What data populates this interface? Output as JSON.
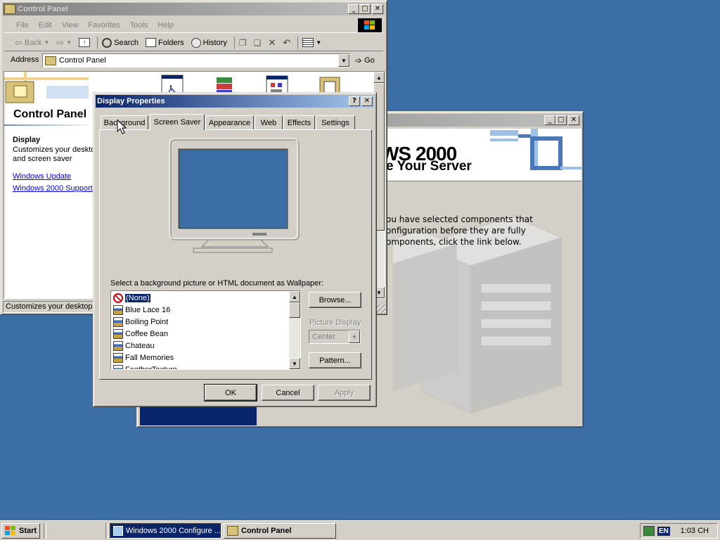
{
  "control_panel": {
    "title": "Control Panel",
    "menu": [
      "File",
      "Edit",
      "View",
      "Favorites",
      "Tools",
      "Help"
    ],
    "toolbar": {
      "back": "Back",
      "search": "Search",
      "folders": "Folders",
      "history": "History"
    },
    "address_label": "Address",
    "address_value": "Control Panel",
    "go_label": "Go",
    "heading": "Control Panel",
    "section_title": "Display",
    "section_desc_1": "Customizes your deskto",
    "section_desc_2": "and screen saver",
    "link_1": "Windows Update",
    "link_2": "Windows 2000 Support",
    "status": "Customizes your desktop d"
  },
  "configure_window": {
    "banner_logo": "WS 2000",
    "banner_sub": "e Your Server",
    "text_1": "ou have selected components that",
    "text_2": "onfiguration before they are fully",
    "text_3": "omponents, click the link below."
  },
  "display_props": {
    "title": "Display Properties",
    "tabs": [
      "Background",
      "Screen Saver",
      "Appearance",
      "Web",
      "Effects",
      "Settings"
    ],
    "selected_tab": "Screen Saver",
    "wallpaper_label": "Select a background picture or HTML document as Wallpaper:",
    "wallpapers": [
      "(None)",
      "Blue Lace 16",
      "Boiling Point",
      "Coffee Bean",
      "Chateau",
      "Fall Memories",
      "FeatherTexture"
    ],
    "selected_wallpaper": "(None)",
    "browse": "Browse...",
    "picture_display_label": "Picture Display:",
    "picture_display_value": "Center",
    "pattern": "Pattern...",
    "ok": "OK",
    "cancel": "Cancel",
    "apply": "Apply",
    "preview_color": "#3a6ea5"
  },
  "taskbar": {
    "start": "Start",
    "tasks": [
      "Windows 2000 Configure ...",
      "Control Panel"
    ],
    "lang": "EN",
    "clock": "1:03 CH"
  },
  "colors": {
    "desktop": "#3a6ea5",
    "title_active": "#0a246a",
    "window_face": "#d4d0c8"
  }
}
